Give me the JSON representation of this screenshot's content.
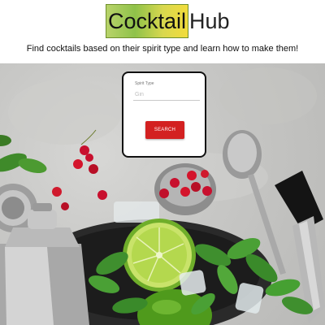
{
  "header": {
    "logo_part1": "Cocktail",
    "logo_part2": "Hub",
    "tagline": "Find cocktails based on their spirit type and learn how to make them!"
  },
  "search": {
    "label": "Spirit Type",
    "placeholder": "Gin",
    "button_label": "SEARCH"
  },
  "colors": {
    "button": "#d32121",
    "logo_gradient_start": "#b8d36a",
    "logo_gradient_end": "#f2dc3c"
  }
}
